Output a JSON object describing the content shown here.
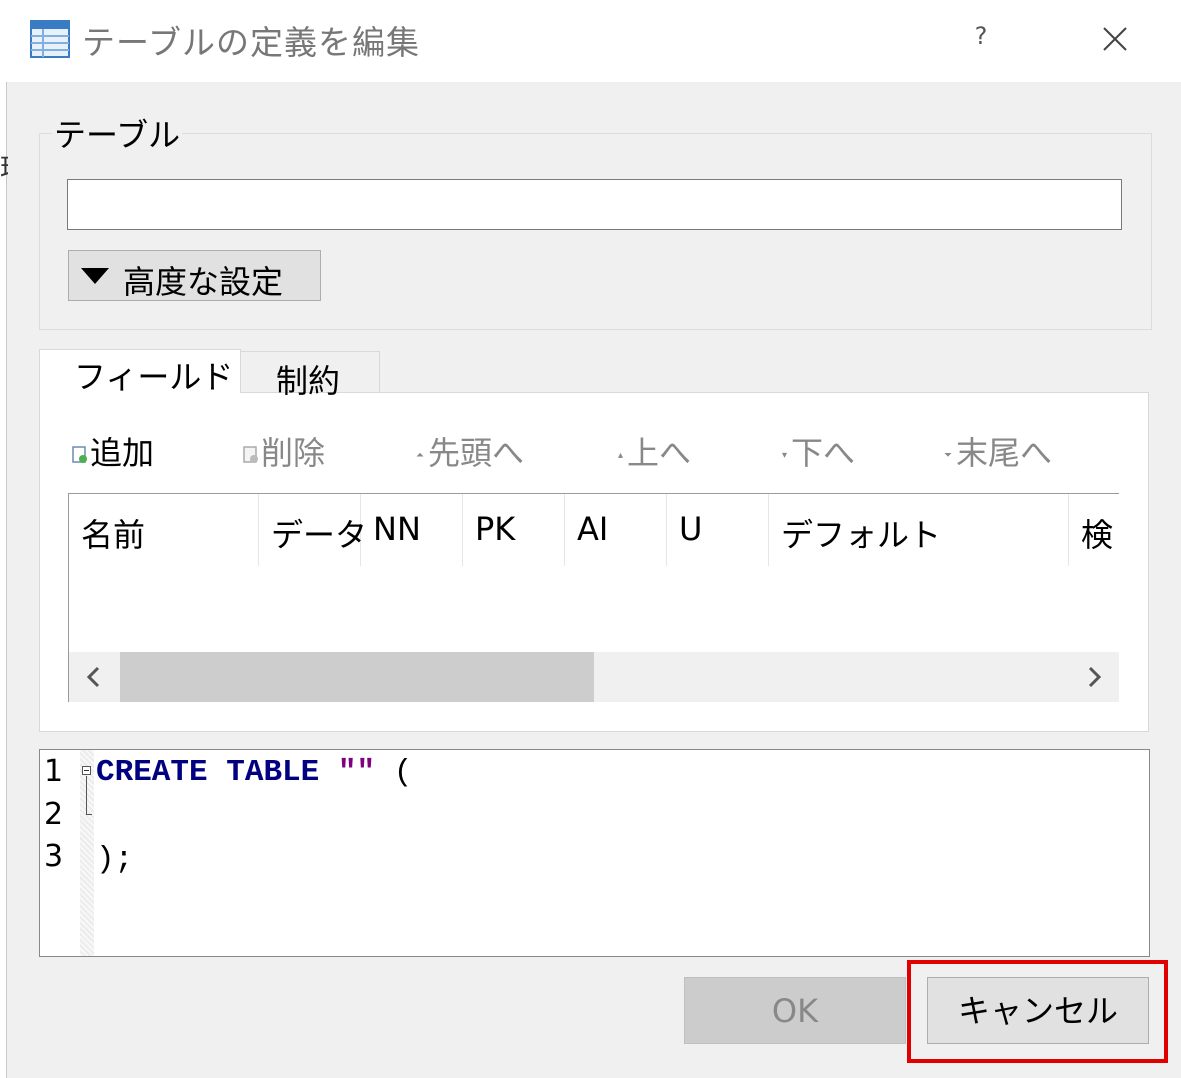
{
  "window": {
    "title": "テーブルの定義を編集",
    "help_label": "?"
  },
  "table_group": {
    "label": "テーブル",
    "name_value": "",
    "advanced_label": "高度な設定"
  },
  "tabs": [
    {
      "label": "フィールド",
      "active": true
    },
    {
      "label": "制約",
      "active": false
    }
  ],
  "toolbar": {
    "add": "追加",
    "delete": "削除",
    "move_top": "先頭へ",
    "move_up": "上へ",
    "move_down": "下へ",
    "move_bottom": "末尾へ"
  },
  "grid": {
    "columns": [
      "名前",
      "データ",
      "NN",
      "PK",
      "AI",
      "U",
      "デフォルト",
      "検"
    ]
  },
  "sql": {
    "line_numbers": [
      "1",
      "2",
      "3"
    ],
    "line1_kw1": "CREATE",
    "line1_kw2": "TABLE",
    "line1_str": "\"\"",
    "line1_paren": "(",
    "line3": ");"
  },
  "buttons": {
    "ok": "OK",
    "cancel": "キャンセル"
  },
  "colors": {
    "keyword": "#000080",
    "string": "#800080",
    "highlight": "#e00000"
  }
}
